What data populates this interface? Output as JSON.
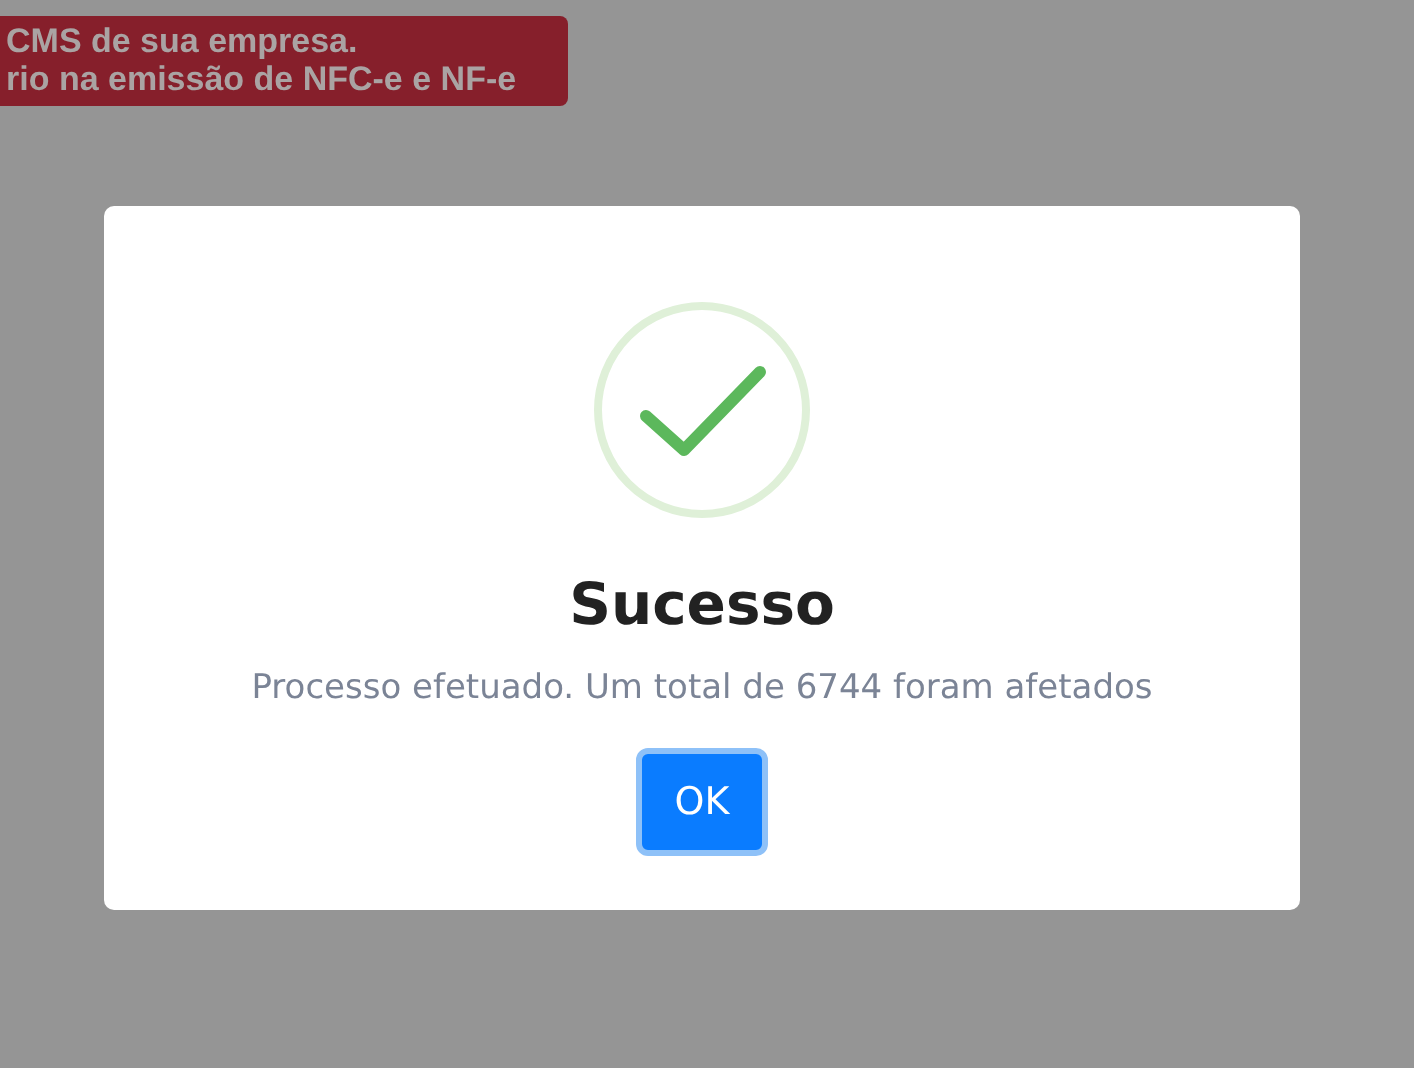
{
  "banner": {
    "lines": [
      "CMS de sua empresa.",
      "rio na emissão de NFC-e e NF-e"
    ]
  },
  "dialog": {
    "kind": "success",
    "title": "Sucesso",
    "message": "Processo efetuado. Um total de 6744 foram afetados",
    "button": "OK"
  }
}
